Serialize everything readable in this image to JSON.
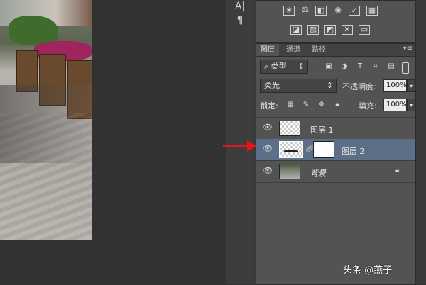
{
  "colors": {
    "accent_selected": "#5c6f87",
    "arrow": "#e8141b"
  },
  "strip": {
    "icons": [
      "char-icon",
      "paragraph-icon"
    ],
    "glyph_1": "A|",
    "glyph_2": "¶"
  },
  "adjustments": {
    "row1": [
      "brightness-icon",
      "levels-icon",
      "curves-icon",
      "exposure-icon",
      "vibrance-icon",
      "color-balance-icon"
    ],
    "row2": [
      "invert-icon",
      "posterize-icon",
      "threshold-icon",
      "selective-color-icon",
      "gradient-map-icon"
    ]
  },
  "layers_panel": {
    "tabs": [
      "图层",
      "通道",
      "路径"
    ],
    "menu_glyph": "▾≡",
    "filter_label": "类型",
    "blend_mode": "柔光",
    "opacity_label": "不透明度:",
    "opacity_value": "100%",
    "lock_label": "锁定:",
    "fill_label": "填充:",
    "fill_value": "100%",
    "layers": [
      {
        "name": "图层 1",
        "selected": false
      },
      {
        "name": "图层 2",
        "selected": true
      },
      {
        "name": "背景",
        "selected": false
      }
    ]
  },
  "watermark": "头条 @燕子"
}
